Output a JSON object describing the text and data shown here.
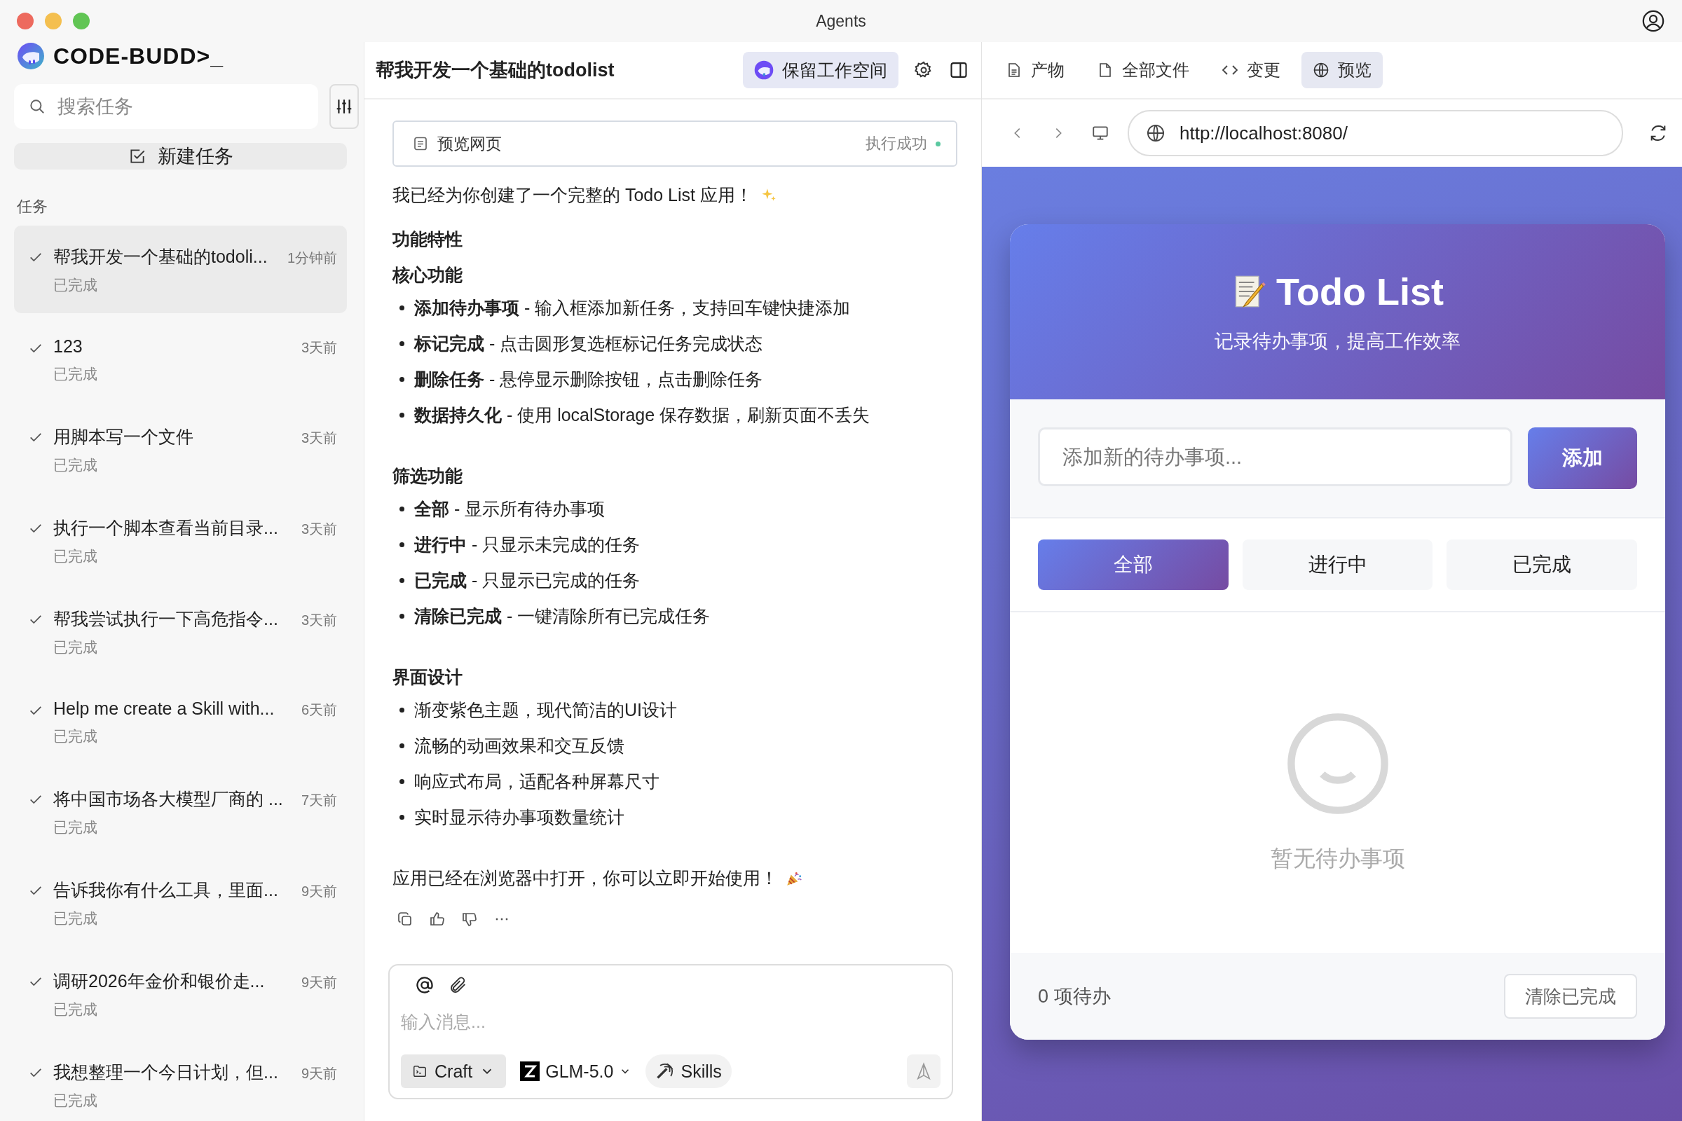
{
  "window": {
    "title": "Agents"
  },
  "sidebar": {
    "logo": "CODE-BUDD>_",
    "search": {
      "placeholder": "搜索任务"
    },
    "new_task": "新建任务",
    "section": "任务",
    "tasks": [
      {
        "title": "帮我开发一个基础的todoli...",
        "time": "1分钟前",
        "status": "已完成",
        "selected": true
      },
      {
        "title": "123",
        "time": "3天前",
        "status": "已完成",
        "selected": false
      },
      {
        "title": "用脚本写一个文件",
        "time": "3天前",
        "status": "已完成",
        "selected": false
      },
      {
        "title": "执行一个脚本查看当前目录...",
        "time": "3天前",
        "status": "已完成",
        "selected": false
      },
      {
        "title": "帮我尝试执行一下高危指令...",
        "time": "3天前",
        "status": "已完成",
        "selected": false
      },
      {
        "title": "Help me create a Skill with...",
        "time": "6天前",
        "status": "已完成",
        "selected": false
      },
      {
        "title": "将中国市场各大模型厂商的 ...",
        "time": "7天前",
        "status": "已完成",
        "selected": false
      },
      {
        "title": "告诉我你有什么工具，里面...",
        "time": "9天前",
        "status": "已完成",
        "selected": false
      },
      {
        "title": "调研2026年金价和银价走...",
        "time": "9天前",
        "status": "已完成",
        "selected": false
      },
      {
        "title": "我想整理一个今日计划，但...",
        "time": "9天前",
        "status": "已完成",
        "selected": false
      }
    ]
  },
  "chat": {
    "title": "帮我开发一个基础的todolist",
    "workspace_button": "保留工作空间",
    "tool_card": {
      "label": "预览网页",
      "status": "执行成功"
    },
    "intro": "我已经为你创建了一个完整的 Todo List 应用！",
    "blocks": [
      {
        "kind": "heading",
        "text": "功能特性"
      },
      {
        "kind": "heading",
        "text": "核心功能"
      },
      {
        "kind": "bullets",
        "items": [
          "**添加待办事项** - 输入框添加新任务，支持回车键快捷添加",
          "**标记完成** - 点击圆形复选框标记任务完成状态",
          "**删除任务** - 悬停显示删除按钮，点击删除任务",
          "**数据持久化** - 使用 localStorage 保存数据，刷新页面不丢失"
        ]
      },
      {
        "kind": "heading",
        "text": "筛选功能"
      },
      {
        "kind": "bullets",
        "items": [
          "**全部** - 显示所有待办事项",
          "**进行中** - 只显示未完成的任务",
          "**已完成** - 只显示已完成的任务",
          "**清除已完成** - 一键清除所有已完成任务"
        ]
      },
      {
        "kind": "heading",
        "text": "界面设计"
      },
      {
        "kind": "bullets",
        "items": [
          "渐变紫色主题，现代简洁的UI设计",
          "流畅的动画效果和交互反馈",
          "响应式布局，适配各种屏幕尺寸",
          "实时显示待办事项数量统计"
        ]
      }
    ],
    "outro": "应用已经在浏览器中打开，你可以立即开始使用！",
    "composer": {
      "placeholder": "输入消息...",
      "mode": "Craft",
      "model": "GLM-5.0",
      "skills": "Skills"
    }
  },
  "preview": {
    "tabs": [
      {
        "label": "产物",
        "selected": false
      },
      {
        "label": "全部文件",
        "selected": false
      },
      {
        "label": "变更",
        "selected": false
      },
      {
        "label": "预览",
        "selected": true
      }
    ],
    "url": "http://localhost:8080/",
    "app": {
      "title": "Todo List",
      "subtitle": "记录待办事项，提高工作效率",
      "input": {
        "placeholder": "添加新的待办事项..."
      },
      "add_button": "添加",
      "filters": [
        {
          "label": "全部",
          "selected": true
        },
        {
          "label": "进行中",
          "selected": false
        },
        {
          "label": "已完成",
          "selected": false
        }
      ],
      "empty_text": "暂无待办事项",
      "count": "0 项待办",
      "clear_button": "清除已完成"
    }
  }
}
